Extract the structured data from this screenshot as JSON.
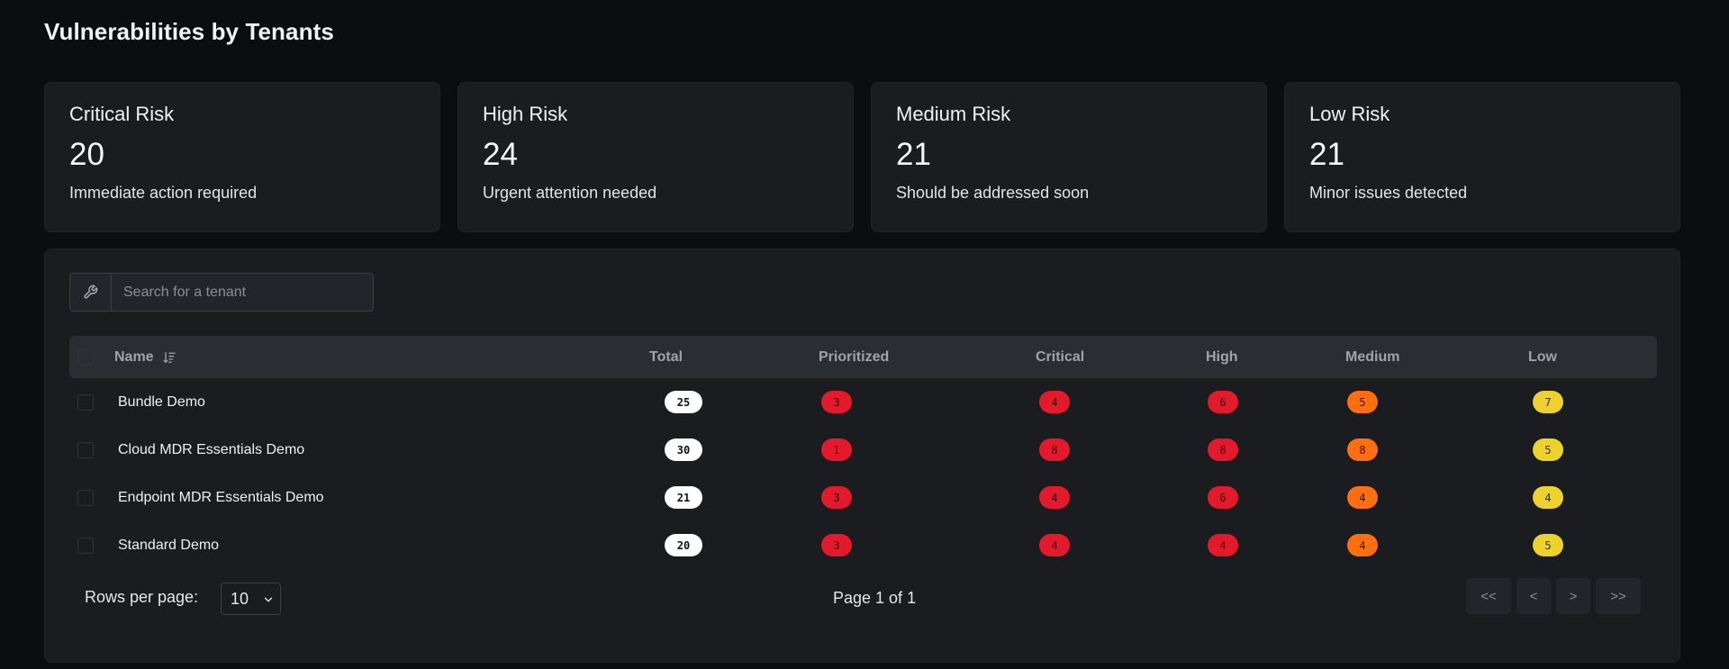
{
  "page": {
    "title": "Vulnerabilities by Tenants"
  },
  "cards": [
    {
      "title": "Critical Risk",
      "value": "20",
      "desc": "Immediate action required"
    },
    {
      "title": "High Risk",
      "value": "24",
      "desc": "Urgent attention needed"
    },
    {
      "title": "Medium Risk",
      "value": "21",
      "desc": "Should be addressed soon"
    },
    {
      "title": "Low Risk",
      "value": "21",
      "desc": "Minor issues detected"
    }
  ],
  "search": {
    "placeholder": "Search for a tenant",
    "value": "",
    "icon": "wrench-icon"
  },
  "table": {
    "columns": [
      "Name",
      "Total",
      "Prioritized",
      "Critical",
      "High",
      "Medium",
      "Low"
    ],
    "sort_icon": "sort-descending-icon",
    "rows": [
      {
        "name": "Bundle Demo",
        "total": "25",
        "prioritized": "3",
        "critical": "4",
        "high": "6",
        "medium": "5",
        "low": "7"
      },
      {
        "name": "Cloud MDR Essentials Demo",
        "total": "30",
        "prioritized": "1",
        "critical": "8",
        "high": "8",
        "medium": "8",
        "low": "5"
      },
      {
        "name": "Endpoint MDR Essentials Demo",
        "total": "21",
        "prioritized": "3",
        "critical": "4",
        "high": "6",
        "medium": "4",
        "low": "4"
      },
      {
        "name": "Standard Demo",
        "total": "20",
        "prioritized": "3",
        "critical": "4",
        "high": "4",
        "medium": "4",
        "low": "5"
      }
    ]
  },
  "pagination": {
    "rows_label": "Rows per page:",
    "rows_value": "10",
    "page_info": "Page 1 of 1",
    "first": "<<",
    "prev": "<",
    "next": ">",
    "last": ">>"
  },
  "colors": {
    "critical": "#e3192c",
    "medium": "#ff6f0f",
    "low": "#ecd12f",
    "total": "#ffffff",
    "background": "#0c0d10",
    "card": "#1a1c20"
  }
}
